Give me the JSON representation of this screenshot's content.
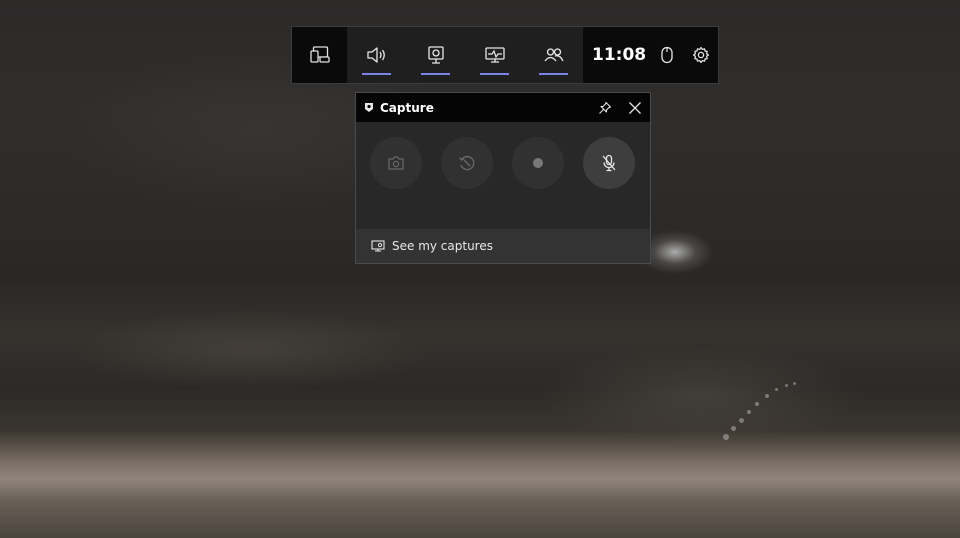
{
  "gamebar": {
    "widgets": [
      {
        "name": "audio",
        "icon": "speaker-icon",
        "active": true
      },
      {
        "name": "capture",
        "icon": "capture-icon",
        "active": true
      },
      {
        "name": "performance",
        "icon": "performance-monitor-icon",
        "active": true
      },
      {
        "name": "social",
        "icon": "people-icon",
        "active": true
      }
    ],
    "clock": "11:08",
    "accent_color": "#7a82e6"
  },
  "capture_widget": {
    "title": "Capture",
    "buttons": [
      {
        "name": "screenshot",
        "icon": "camera-icon",
        "enabled": false
      },
      {
        "name": "record-last-30s",
        "icon": "history-icon",
        "enabled": false
      },
      {
        "name": "start-recording",
        "icon": "record-dot-icon",
        "enabled": false
      },
      {
        "name": "microphone",
        "icon": "mic-off-icon",
        "enabled": true
      }
    ],
    "footer_link": "See my captures"
  }
}
